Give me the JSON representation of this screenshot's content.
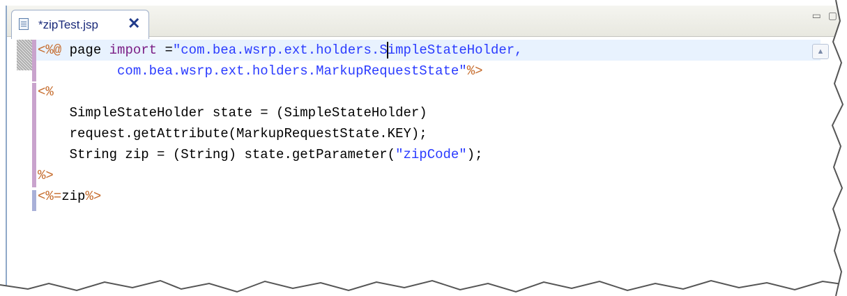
{
  "tab": {
    "label": "*zipTest.jsp",
    "close_glyph": "✕",
    "icon": "jsp-file-icon"
  },
  "window_controls": {
    "minimize_glyph": "▭",
    "maximize_glyph": "▢"
  },
  "code": {
    "line1": {
      "open": "<%@",
      "directive": " page ",
      "attr": "import",
      "eq": " =",
      "value_before": "\"com.bea.wsrp.ext.holders.S",
      "value_after": "impleStateHolder,"
    },
    "line2": {
      "indent": "          ",
      "value": "com.bea.wsrp.ext.holders.MarkupRequestState\"",
      "close": "%>"
    },
    "line3": {
      "open": "<%"
    },
    "line4": {
      "text": "    SimpleStateHolder state = (SimpleStateHolder)"
    },
    "line5": {
      "text": "    request.getAttribute(MarkupRequestState.KEY);"
    },
    "line6": {
      "before": "    String zip = (String) state.getParameter(",
      "string": "\"zipCode\"",
      "after": ");"
    },
    "line7": {
      "close": "%>"
    },
    "line8": {
      "open": "<%=",
      "expr": "zip",
      "close": "%>"
    }
  },
  "scrollbar": {
    "up_glyph": "▲"
  },
  "colors": {
    "jsp_delimiter": "#c56a2a",
    "keyword": "#7b1f86",
    "string": "#2a3bff",
    "current_line": "#e8f2fe",
    "change_bar": "#c9a3cd"
  }
}
